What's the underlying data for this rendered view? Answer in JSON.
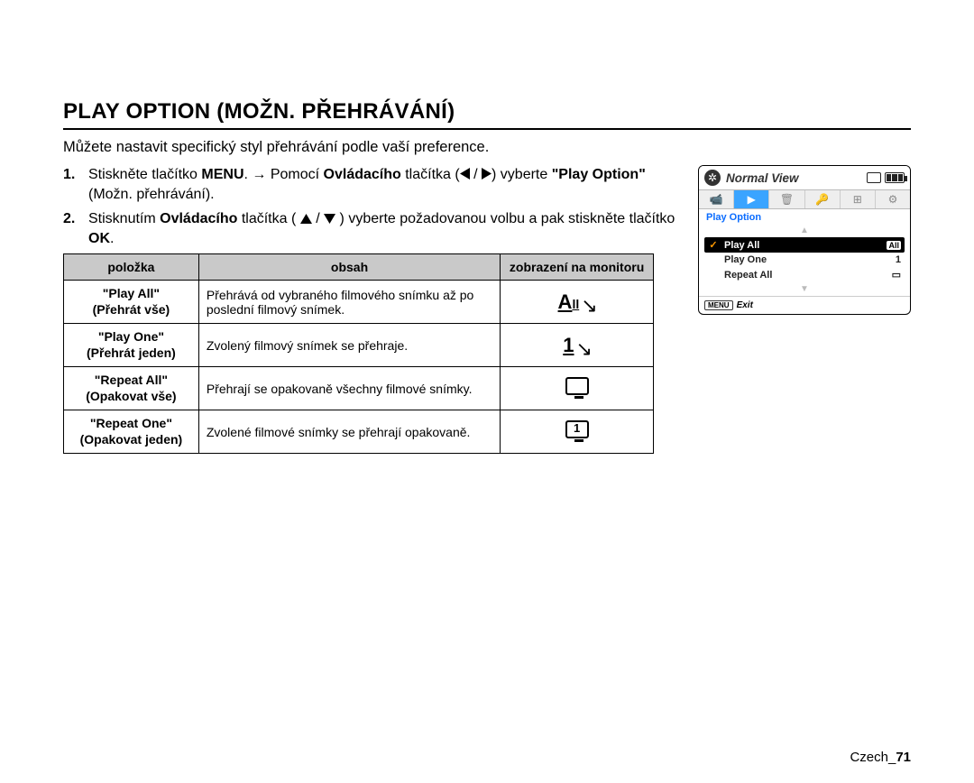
{
  "title": "PLAY OPTION (MOŽN. PŘEHRÁVÁNÍ)",
  "intro": "Můžete nastavit specifický styl přehrávání podle vaší preference.",
  "steps": {
    "s1_num": "1.",
    "s1_a": "Stiskněte tlačítko ",
    "s1_menu": "MENU",
    "s1_b": ". ",
    "s1_arrow": "→",
    "s1_c": " Pomocí ",
    "s1_ovl": "Ovládacího",
    "s1_d": " tlačítka (",
    "s1_e": " / ",
    "s1_f": ") vyberte ",
    "s1_quote": "\"Play Option\"",
    "s1_g": " (Možn. přehrávání).",
    "s2_num": "2.",
    "s2_a": "Stisknutím ",
    "s2_ovl": "Ovládacího",
    "s2_b": " tlačítka ( ",
    "s2_c": " / ",
    "s2_d": " ) vyberte požadovanou volbu a pak stiskněte tlačítko ",
    "s2_ok": "OK",
    "s2_e": "."
  },
  "table": {
    "h1": "položka",
    "h2": "obsah",
    "h3": "zobrazení na monitoru",
    "rows": [
      {
        "name1": "\"Play All\"",
        "name2": "(Přehrát vše)",
        "desc": "Přehrává od vybraného filmového snímku až po poslední filmový snímek.",
        "icon": "all"
      },
      {
        "name1": "\"Play One\"",
        "name2": "(Přehrát jeden)",
        "desc": "Zvolený filmový snímek se přehraje.",
        "icon": "one"
      },
      {
        "name1": "\"Repeat All\"",
        "name2": "(Opakovat vše)",
        "desc": "Přehrají se opakovaně všechny filmové snímky.",
        "icon": "repeat-all"
      },
      {
        "name1": "\"Repeat One\"",
        "name2": "(Opakovat jeden)",
        "desc": "Zvolené filmové snímky se přehrají opakovaně.",
        "icon": "repeat-one"
      }
    ]
  },
  "osd": {
    "title": "Normal View",
    "tabs": [
      "📹",
      "▶",
      "🗑",
      "🔑",
      "⊞",
      "⚙"
    ],
    "active_tab_index": 1,
    "section": "Play Option",
    "items": [
      {
        "label": "Play All",
        "selected": true,
        "badge": "All"
      },
      {
        "label": "Play One",
        "selected": false,
        "badge": "1"
      },
      {
        "label": "Repeat All",
        "selected": false,
        "badge": "▭"
      }
    ],
    "footer_btn": "MENU",
    "footer_label": "Exit"
  },
  "footer": {
    "lang": "Czech",
    "sep": "_",
    "page": "71"
  }
}
